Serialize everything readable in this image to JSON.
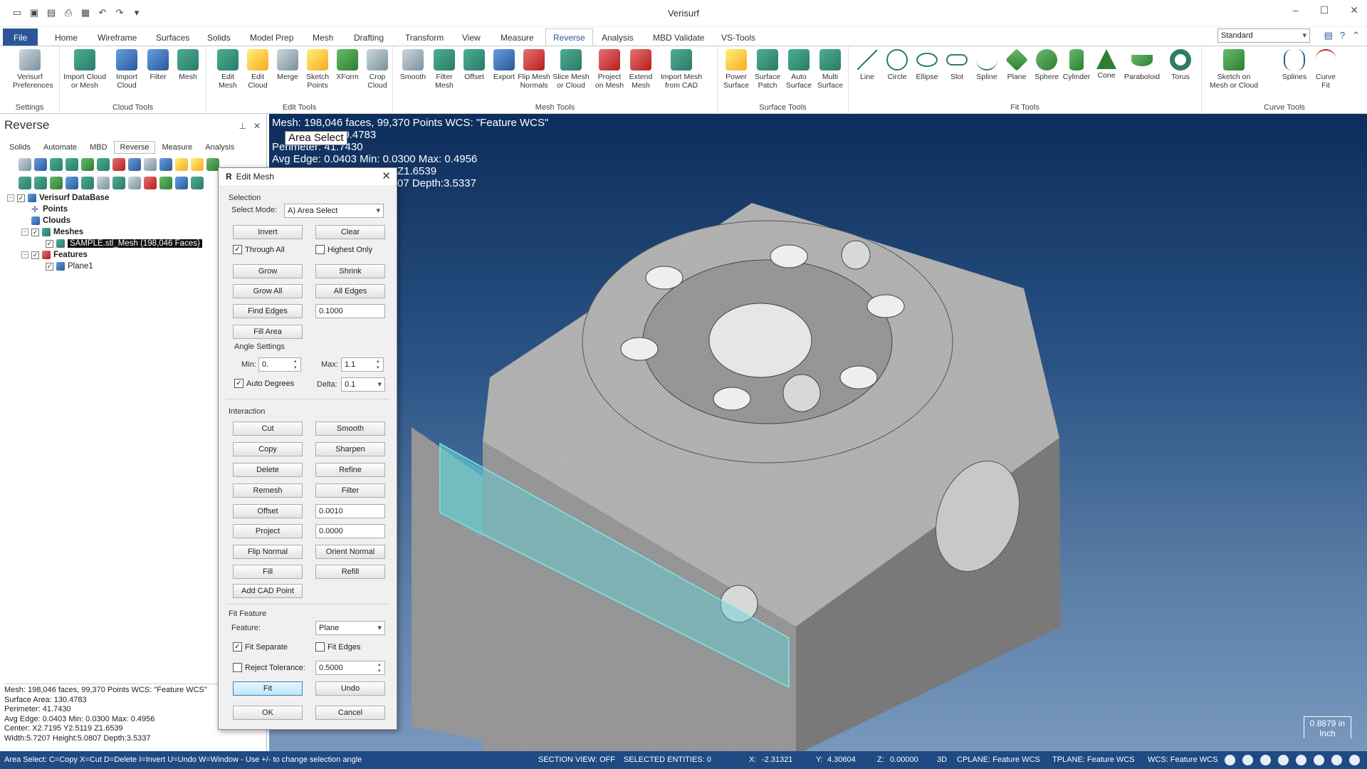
{
  "app": {
    "title": "Verisurf"
  },
  "qat": {
    "items": [
      "new-icon",
      "save-icon",
      "open-icon",
      "print-icon",
      "saveall-icon",
      "undo-icon",
      "redo-icon",
      "customize-icon"
    ]
  },
  "tabs": [
    "File",
    "Home",
    "Wireframe",
    "Surfaces",
    "Solids",
    "Model Prep",
    "Mesh",
    "Drafting",
    "Transform",
    "View",
    "Measure",
    "Reverse",
    "Analysis",
    "MBD Validate",
    "VS-Tools"
  ],
  "active_tab": "Reverse",
  "standard": "Standard",
  "ribbon": {
    "groups": [
      "Settings",
      "Cloud Tools",
      "Edit Tools",
      "Mesh Tools",
      "Surface Tools",
      "Fit Tools",
      "Curve Tools"
    ],
    "buttons": [
      {
        "label": "Verisurf\nPreferences"
      },
      {
        "label": "Import Cloud\nor Mesh"
      },
      {
        "label": "Import\nCloud"
      },
      {
        "label": "Filter"
      },
      {
        "label": "Mesh"
      },
      {
        "label": "Edit\nMesh"
      },
      {
        "label": "Edit\nCloud"
      },
      {
        "label": "Merge"
      },
      {
        "label": "Sketch\nPoints"
      },
      {
        "label": "XForm"
      },
      {
        "label": "Crop\nCloud"
      },
      {
        "label": "Smooth"
      },
      {
        "label": "Filter\nMesh"
      },
      {
        "label": "Offset"
      },
      {
        "label": "Export"
      },
      {
        "label": "Flip Mesh\nNormals"
      },
      {
        "label": "Slice Mesh\nor Cloud"
      },
      {
        "label": "Project\non Mesh"
      },
      {
        "label": "Extend\nMesh"
      },
      {
        "label": "Import Mesh\nfrom CAD"
      },
      {
        "label": "Power\nSurface"
      },
      {
        "label": "Surface\nPatch"
      },
      {
        "label": "Auto\nSurface"
      },
      {
        "label": "Multi\nSurface"
      },
      {
        "label": "Line"
      },
      {
        "label": "Circle"
      },
      {
        "label": "Ellipse"
      },
      {
        "label": "Slot"
      },
      {
        "label": "Spline"
      },
      {
        "label": "Plane"
      },
      {
        "label": "Sphere"
      },
      {
        "label": "Cylinder"
      },
      {
        "label": "Cone"
      },
      {
        "label": "Paraboloid"
      },
      {
        "label": "Torus"
      },
      {
        "label": "Sketch on\nMesh or Cloud"
      },
      {
        "label": "Splines"
      },
      {
        "label": "Curve\nFit"
      }
    ]
  },
  "panel": {
    "title": "Reverse",
    "subtabs": [
      "Solids",
      "Automate",
      "MBD",
      "Reverse",
      "Measure",
      "Analysis"
    ],
    "tree": {
      "db": "Verisurf DataBase",
      "points": "Points",
      "clouds": "Clouds",
      "meshes": "Meshes",
      "mesh_item": "SAMPLE.stl_Mesh (198,046 Faces)",
      "features": "Features",
      "plane": "Plane1"
    },
    "info": [
      "Mesh: 198,046 faces, 99,370 Points  WCS: \"Feature WCS\"",
      "Surface Area: 130.4783",
      "Perimeter: 41.7430",
      "Avg Edge: 0.0403 Min: 0.0300 Max: 0.4956",
      "Center: X2.7195 Y2.5119 Z1.6539",
      "Width:5.7207 Height:5.0807 Depth:3.5337"
    ]
  },
  "viewport": {
    "info_line1": "Mesh: 198,046 faces, 99,370 Points  WCS: \"Feature WCS\"",
    "info_line2_suffix": "30.4783",
    "info_line3": "Perimeter: 41.7430",
    "info_line4": "Avg Edge: 0.0403 Min: 0.0300 Max: 0.4956",
    "info_line5_suffix": "Z1.6539",
    "info_line6_suffix": "07 Depth:3.5337",
    "tooltip": "Area Select",
    "scale_value": "0.8879 in",
    "scale_unit": "Inch"
  },
  "dialog": {
    "title": "Edit Mesh",
    "selection_label": "Selection",
    "select_mode_label": "Select Mode:",
    "select_mode_value": "A) Area Select",
    "invert": "Invert",
    "clear": "Clear",
    "through_all": "Through All",
    "highest_only": "Highest Only",
    "grow": "Grow",
    "shrink": "Shrink",
    "grow_all": "Grow All",
    "all_edges": "All Edges",
    "find_edges": "Find Edges",
    "find_edges_value": "0.1000",
    "fill_area": "Fill Area",
    "angle_settings": "Angle Settings",
    "min_label": "Min:",
    "min_value": "0.",
    "max_label": "Max:",
    "max_value": "1.1",
    "auto_degrees": "Auto Degrees",
    "delta_label": "Delta:",
    "delta_value": "0.1",
    "interaction": "Interaction",
    "cut": "Cut",
    "smooth": "Smooth",
    "copy": "Copy",
    "sharpen": "Sharpen",
    "delete": "Delete",
    "refine": "Refine",
    "remesh": "Remesh",
    "filter": "Filter",
    "offset": "Offset",
    "offset_value": "0.0010",
    "project": "Project",
    "project_value": "0.0000",
    "flip_normal": "Flip Normal",
    "orient_normal": "Orient Normal",
    "fill": "Fill",
    "refill": "Refill",
    "add_cad_point": "Add CAD Point",
    "fit_feature": "Fit Feature",
    "feature_label": "Feature:",
    "feature_value": "Plane",
    "fit_separate": "Fit Separate",
    "fit_edges": "Fit Edges",
    "reject_tolerance": "Reject Tolerance:",
    "reject_value": "0.5000",
    "fit": "Fit",
    "undo": "Undo",
    "ok": "OK",
    "cancel": "Cancel"
  },
  "statusbar": {
    "hint": "Area Select: C=Copy X=Cut D=Delete I=Invert U=Undo W=Window - Use +/- to change selection angle",
    "section_view": "SECTION VIEW: OFF",
    "selected": "SELECTED ENTITIES: 0",
    "x_label": "X:",
    "x": "-2.31321",
    "y_label": "Y:",
    "y": "4.30604",
    "z_label": "Z:",
    "z": "0.00000",
    "mode": "3D",
    "cplane": "CPLANE: Feature WCS",
    "tplane": "TPLANE: Feature WCS",
    "wcs": "WCS: Feature WCS"
  },
  "colors": {
    "accent": "#2b579a",
    "statusbar": "#1f4a84",
    "selection": "#5fd3d6"
  }
}
